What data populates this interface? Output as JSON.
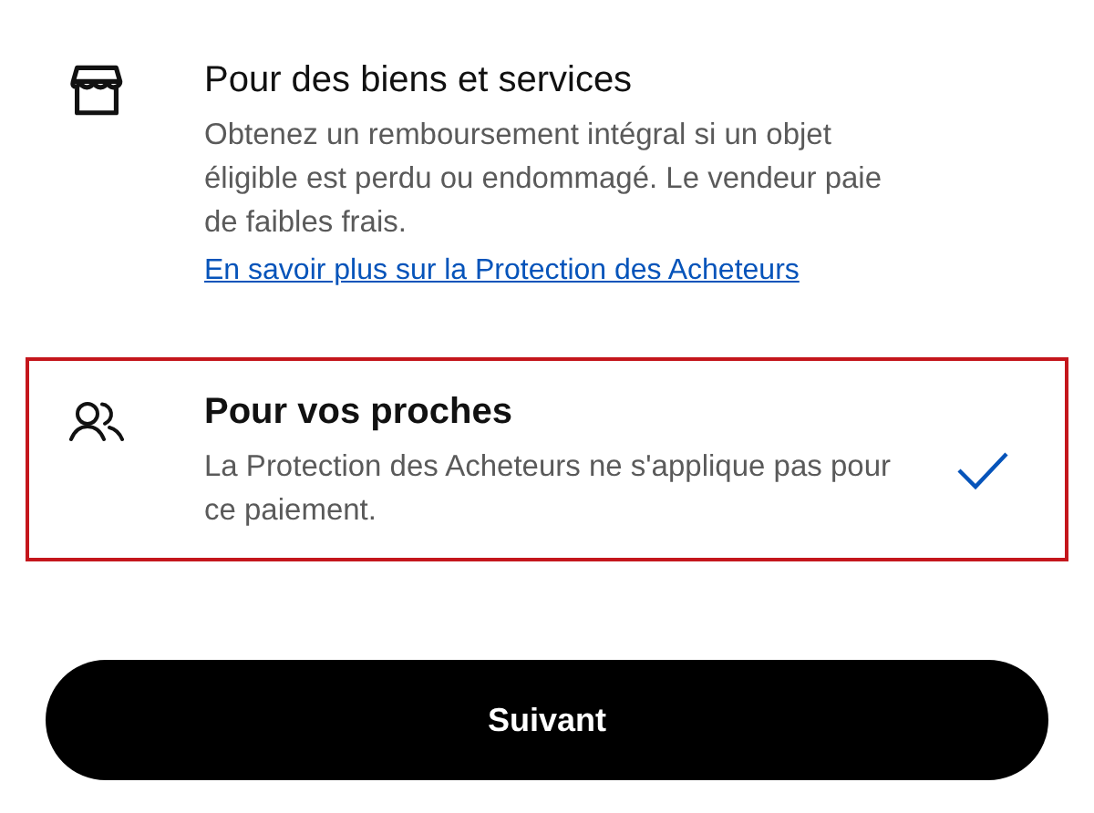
{
  "options": [
    {
      "kind": "store",
      "title": "Pour des biens et services",
      "description": "Obtenez un remboursement intégral si un objet éligible est perdu ou endommagé. Le vendeur paie de faibles frais.",
      "link": "En savoir plus sur la Protection des Acheteurs",
      "selected": false
    },
    {
      "kind": "people",
      "title": "Pour vos proches",
      "description": "La Protection des Acheteurs ne s'applique pas pour ce paiement.",
      "selected": true
    }
  ],
  "button": "Suivant"
}
